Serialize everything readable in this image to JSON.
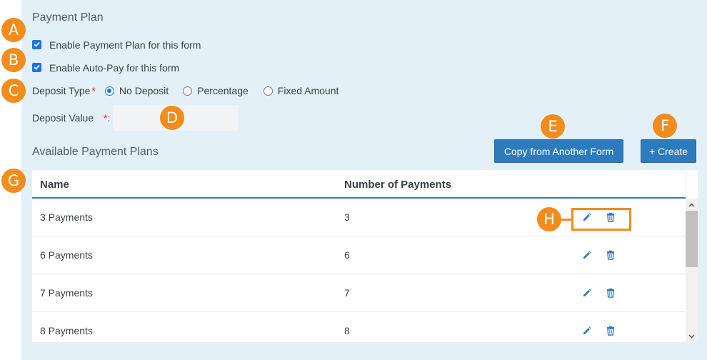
{
  "section_title": "Payment Plan",
  "checkboxes": [
    {
      "label": "Enable Payment Plan for this form",
      "checked": true
    },
    {
      "label": "Enable Auto-Pay for this form",
      "checked": true
    }
  ],
  "deposit_type": {
    "label": "Deposit Type",
    "required_marker": "*",
    "options": [
      "No Deposit",
      "Percentage",
      "Fixed Amount"
    ],
    "selected": "No Deposit"
  },
  "deposit_value": {
    "label": "Deposit Value",
    "required_marker": "*",
    "colon": ":",
    "value": ""
  },
  "available": {
    "title": "Available Payment Plans",
    "copy_button": "Copy from Another Form",
    "create_button": "+ Create"
  },
  "table": {
    "headers": [
      "Name",
      "Number of Payments"
    ],
    "rows": [
      {
        "name": "3 Payments",
        "count": "3"
      },
      {
        "name": "6 Payments",
        "count": "6"
      },
      {
        "name": "7 Payments",
        "count": "7"
      },
      {
        "name": "8 Payments",
        "count": "8"
      }
    ]
  },
  "annotations": [
    "A",
    "B",
    "C",
    "D",
    "E",
    "F",
    "G",
    "H"
  ],
  "colors": {
    "accent": "#2d7bbf",
    "badge": "#f28c1a",
    "panel_bg": "#e3f0f8",
    "required": "#e0232a"
  },
  "icons": [
    "check-icon",
    "edit-pencil-icon",
    "trash-icon",
    "scroll-up-icon",
    "scroll-down-icon"
  ]
}
